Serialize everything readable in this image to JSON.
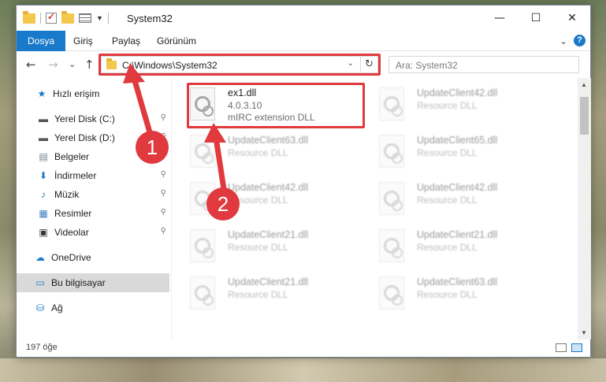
{
  "window": {
    "title": "System32",
    "minimize": "—",
    "maximize": "☐",
    "close": "✕"
  },
  "ribbon": {
    "tabs": [
      "Dosya",
      "Giriş",
      "Paylaş",
      "Görünüm"
    ],
    "collapse_icon": "⌄",
    "help": "?"
  },
  "nav": {
    "back": "←",
    "forward": "→",
    "recent": "⌄",
    "up": "↑",
    "address": "C:\\Windows\\System32",
    "refresh": "↻",
    "search_placeholder": "Ara: System32"
  },
  "sidebar": {
    "items": [
      {
        "label": "Hızlı erişim",
        "icon": "star-icon",
        "glyph": "★",
        "color": "#1979ca",
        "pinned": false
      },
      {
        "label": "Yerel Disk (C:)",
        "icon": "drive-icon",
        "glyph": "▬",
        "color": "#555555",
        "pinned": true
      },
      {
        "label": "Yerel Disk (D:)",
        "icon": "drive-icon",
        "glyph": "▬",
        "color": "#555555",
        "pinned": true
      },
      {
        "label": "Belgeler",
        "icon": "documents-icon",
        "glyph": "▤",
        "color": "#6b7d8f",
        "pinned": true
      },
      {
        "label": "İndirmeler",
        "icon": "downloads-icon",
        "glyph": "⬇",
        "color": "#1979ca",
        "pinned": true
      },
      {
        "label": "Müzik",
        "icon": "music-icon",
        "glyph": "♪",
        "color": "#1979ca",
        "pinned": true
      },
      {
        "label": "Resimler",
        "icon": "pictures-icon",
        "glyph": "▦",
        "color": "#3c7bbf",
        "pinned": true
      },
      {
        "label": "Videolar",
        "icon": "videos-icon",
        "glyph": "▣",
        "color": "#333333",
        "pinned": true
      },
      {
        "label": "OneDrive",
        "icon": "cloud-icon",
        "glyph": "☁",
        "color": "#1979ca",
        "pinned": false
      },
      {
        "label": "Bu bilgisayar",
        "icon": "computer-icon",
        "glyph": "▭",
        "color": "#1979ca",
        "pinned": false,
        "selected": true
      },
      {
        "label": "Ağ",
        "icon": "network-icon",
        "glyph": "⛁",
        "color": "#1979ca",
        "pinned": false
      }
    ],
    "pin_glyph": "📌"
  },
  "files": [
    {
      "name": "ex1.dll",
      "line2": "4.0.3.10",
      "line3": "mIRC extension DLL",
      "highlighted": true
    },
    {
      "name": "UpdateClient42.dll",
      "line2": "Resource DLL",
      "line3": ""
    },
    {
      "name": "UpdateClient63.dll",
      "line2": "Resource DLL",
      "line3": ""
    },
    {
      "name": "UpdateClient65.dll",
      "line2": "Resource DLL",
      "line3": ""
    },
    {
      "name": "UpdateClient42.dll",
      "line2": "Resource DLL",
      "line3": ""
    },
    {
      "name": "UpdateClient42.dll",
      "line2": "Resource DLL",
      "line3": ""
    },
    {
      "name": "UpdateClient21.dll",
      "line2": "Resource DLL",
      "line3": ""
    },
    {
      "name": "UpdateClient21.dll",
      "line2": "Resource DLL",
      "line3": ""
    },
    {
      "name": "UpdateClient21.dll",
      "line2": "Resource DLL",
      "line3": ""
    },
    {
      "name": "UpdateClient63.dll",
      "line2": "Resource DLL",
      "line3": ""
    }
  ],
  "status": {
    "count": "197 öğe"
  },
  "annotations": {
    "step1": "1",
    "step2": "2",
    "color": "#e0393e"
  }
}
